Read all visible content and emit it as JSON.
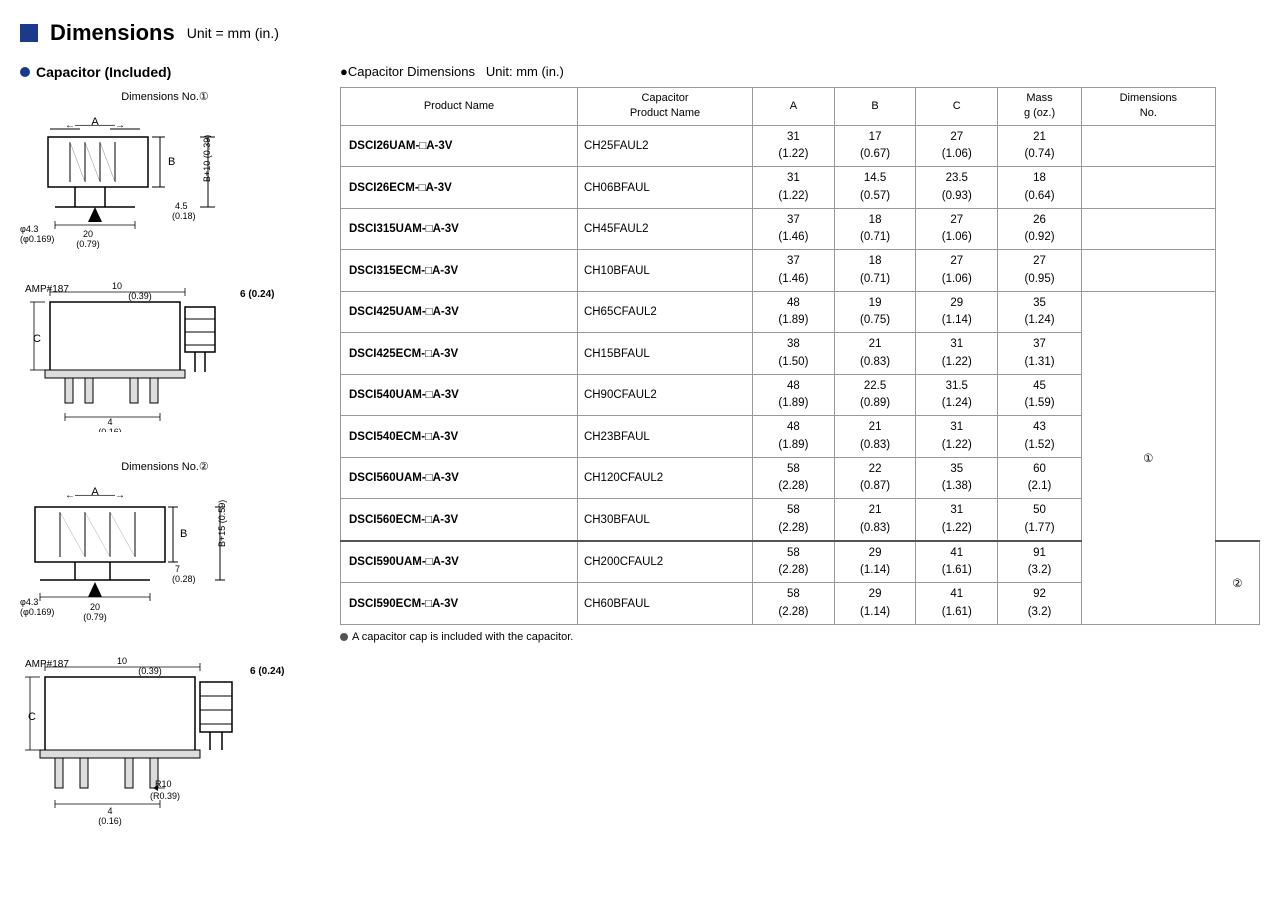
{
  "header": {
    "title": "Dimensions",
    "unit": "Unit = mm (in.)"
  },
  "left": {
    "section_title": "Capacitor (Included)",
    "dim1_label": "Dimensions No.①",
    "dim2_label": "Dimensions No.②"
  },
  "right": {
    "cap_dim_title": "●Capacitor Dimensions",
    "cap_dim_unit": "Unit: mm (in.)",
    "table": {
      "headers": [
        "Product Name",
        "Capacitor\nProduct Name",
        "A",
        "B",
        "C",
        "Mass\ng (oz.)",
        "Dimensions\nNo."
      ],
      "rows": [
        {
          "product": "DSCI26UAM-□A-3V",
          "cap": "CH25FAUL2",
          "a": "31\n(1.22)",
          "b": "17\n(0.67)",
          "c": "27\n(1.06)",
          "mass": "21\n(0.74)",
          "dim_no": "",
          "group_end": false
        },
        {
          "product": "DSCI26ECM-□A-3V",
          "cap": "CH06BFAUL",
          "a": "31\n(1.22)",
          "b": "14.5\n(0.57)",
          "c": "23.5\n(0.93)",
          "mass": "18\n(0.64)",
          "dim_no": "",
          "group_end": false
        },
        {
          "product": "DSCI315UAM-□A-3V",
          "cap": "CH45FAUL2",
          "a": "37\n(1.46)",
          "b": "18\n(0.71)",
          "c": "27\n(1.06)",
          "mass": "26\n(0.92)",
          "dim_no": "",
          "group_end": false
        },
        {
          "product": "DSCI315ECM-□A-3V",
          "cap": "CH10BFAUL",
          "a": "37\n(1.46)",
          "b": "18\n(0.71)",
          "c": "27\n(1.06)",
          "mass": "27\n(0.95)",
          "dim_no": "",
          "group_end": false
        },
        {
          "product": "DSCI425UAM-□A-3V",
          "cap": "CH65CFAUL2",
          "a": "48\n(1.89)",
          "b": "19\n(0.75)",
          "c": "29\n(1.14)",
          "mass": "35\n(1.24)",
          "dim_no": "①",
          "dim_no_rowspan": 8,
          "group_end": false
        },
        {
          "product": "DSCI425ECM-□A-3V",
          "cap": "CH15BFAUL",
          "a": "38\n(1.50)",
          "b": "21\n(0.83)",
          "c": "31\n(1.22)",
          "mass": "37\n(1.31)",
          "dim_no": null,
          "group_end": false
        },
        {
          "product": "DSCI540UAM-□A-3V",
          "cap": "CH90CFAUL2",
          "a": "48\n(1.89)",
          "b": "22.5\n(0.89)",
          "c": "31.5\n(1.24)",
          "mass": "45\n(1.59)",
          "dim_no": null,
          "group_end": false
        },
        {
          "product": "DSCI540ECM-□A-3V",
          "cap": "CH23BFAUL",
          "a": "48\n(1.89)",
          "b": "21\n(0.83)",
          "c": "31\n(1.22)",
          "mass": "43\n(1.52)",
          "dim_no": null,
          "group_end": false
        },
        {
          "product": "DSCI560UAM-□A-3V",
          "cap": "CH120CFAUL2",
          "a": "58\n(2.28)",
          "b": "22\n(0.87)",
          "c": "35\n(1.38)",
          "mass": "60\n(2.1)",
          "dim_no": null,
          "group_end": false
        },
        {
          "product": "DSCI560ECM-□A-3V",
          "cap": "CH30BFAUL",
          "a": "58\n(2.28)",
          "b": "21\n(0.83)",
          "c": "31\n(1.22)",
          "mass": "50\n(1.77)",
          "dim_no": null,
          "group_end": true
        },
        {
          "product": "DSCI590UAM-□A-3V",
          "cap": "CH200CFAUL2",
          "a": "58\n(2.28)",
          "b": "29\n(1.14)",
          "c": "41\n(1.61)",
          "mass": "91\n(3.2)",
          "dim_no": "②",
          "dim_no_rowspan": 2,
          "group_end": false
        },
        {
          "product": "DSCI590ECM-□A-3V",
          "cap": "CH60BFAUL",
          "a": "58\n(2.28)",
          "b": "29\n(1.14)",
          "c": "41\n(1.61)",
          "mass": "92\n(3.2)",
          "dim_no": null,
          "group_end": false
        }
      ]
    },
    "footnote": "A capacitor cap is included with the capacitor."
  }
}
